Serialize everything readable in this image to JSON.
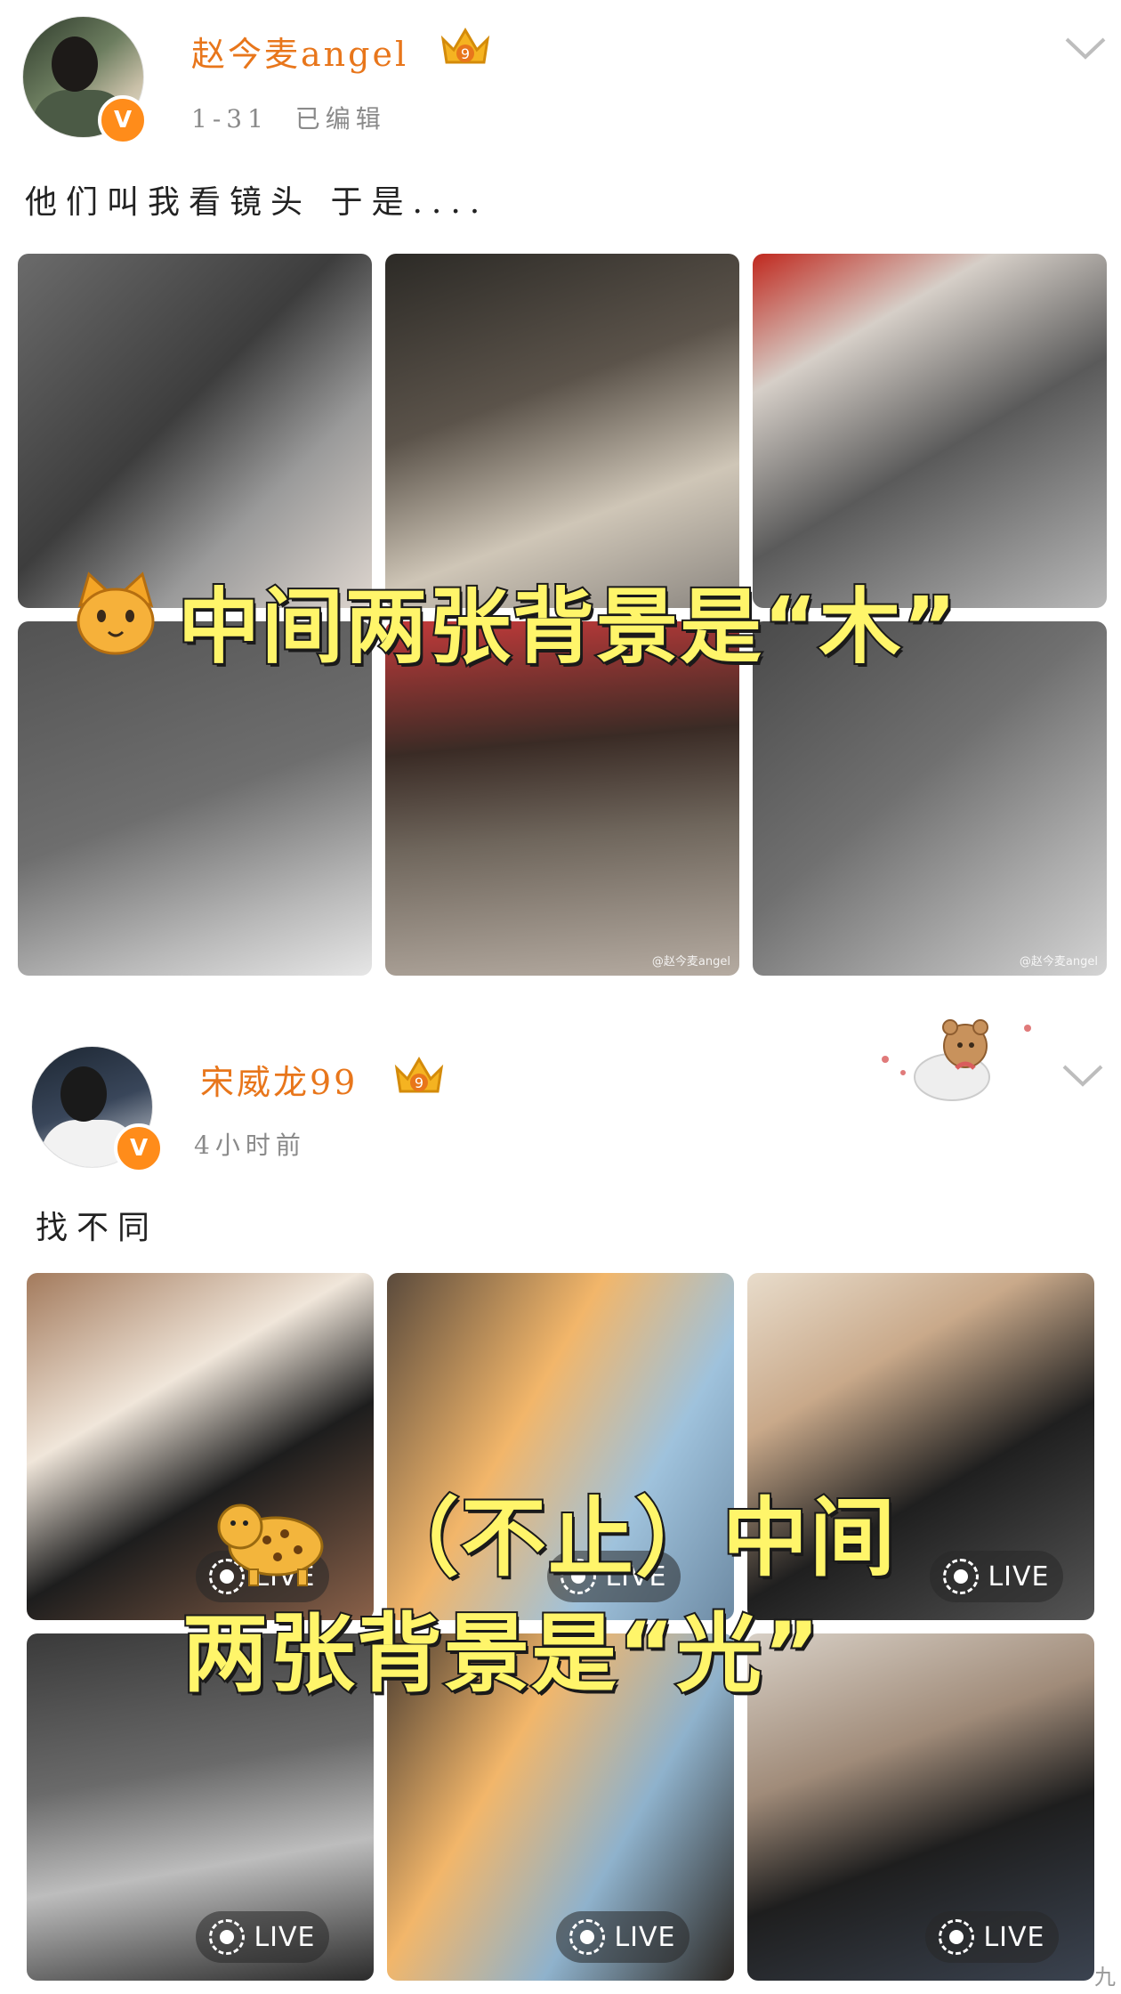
{
  "post1": {
    "username": "赵今麦angel",
    "level_badge": "9",
    "time": "1-31",
    "edited": "已编辑",
    "text": "他们叫我看镜头 于是....",
    "overlay_text": "中间两张背景是“木”",
    "overlay_emoji": "cat-face-icon",
    "watermark": "@赵今麦angel"
  },
  "post2": {
    "username": "宋威龙99",
    "level_badge": "9",
    "time": "4小时前",
    "text": "找不同",
    "overlay_line1": "（不止）中间",
    "overlay_line2": "两张背景是“光”",
    "overlay_emoji": "leopard-icon",
    "live_label": "LIVE"
  },
  "colors": {
    "username": "#e8761b",
    "verified": "#ff8c1a",
    "overlay_fill": "#fff56a"
  },
  "corner": "九"
}
